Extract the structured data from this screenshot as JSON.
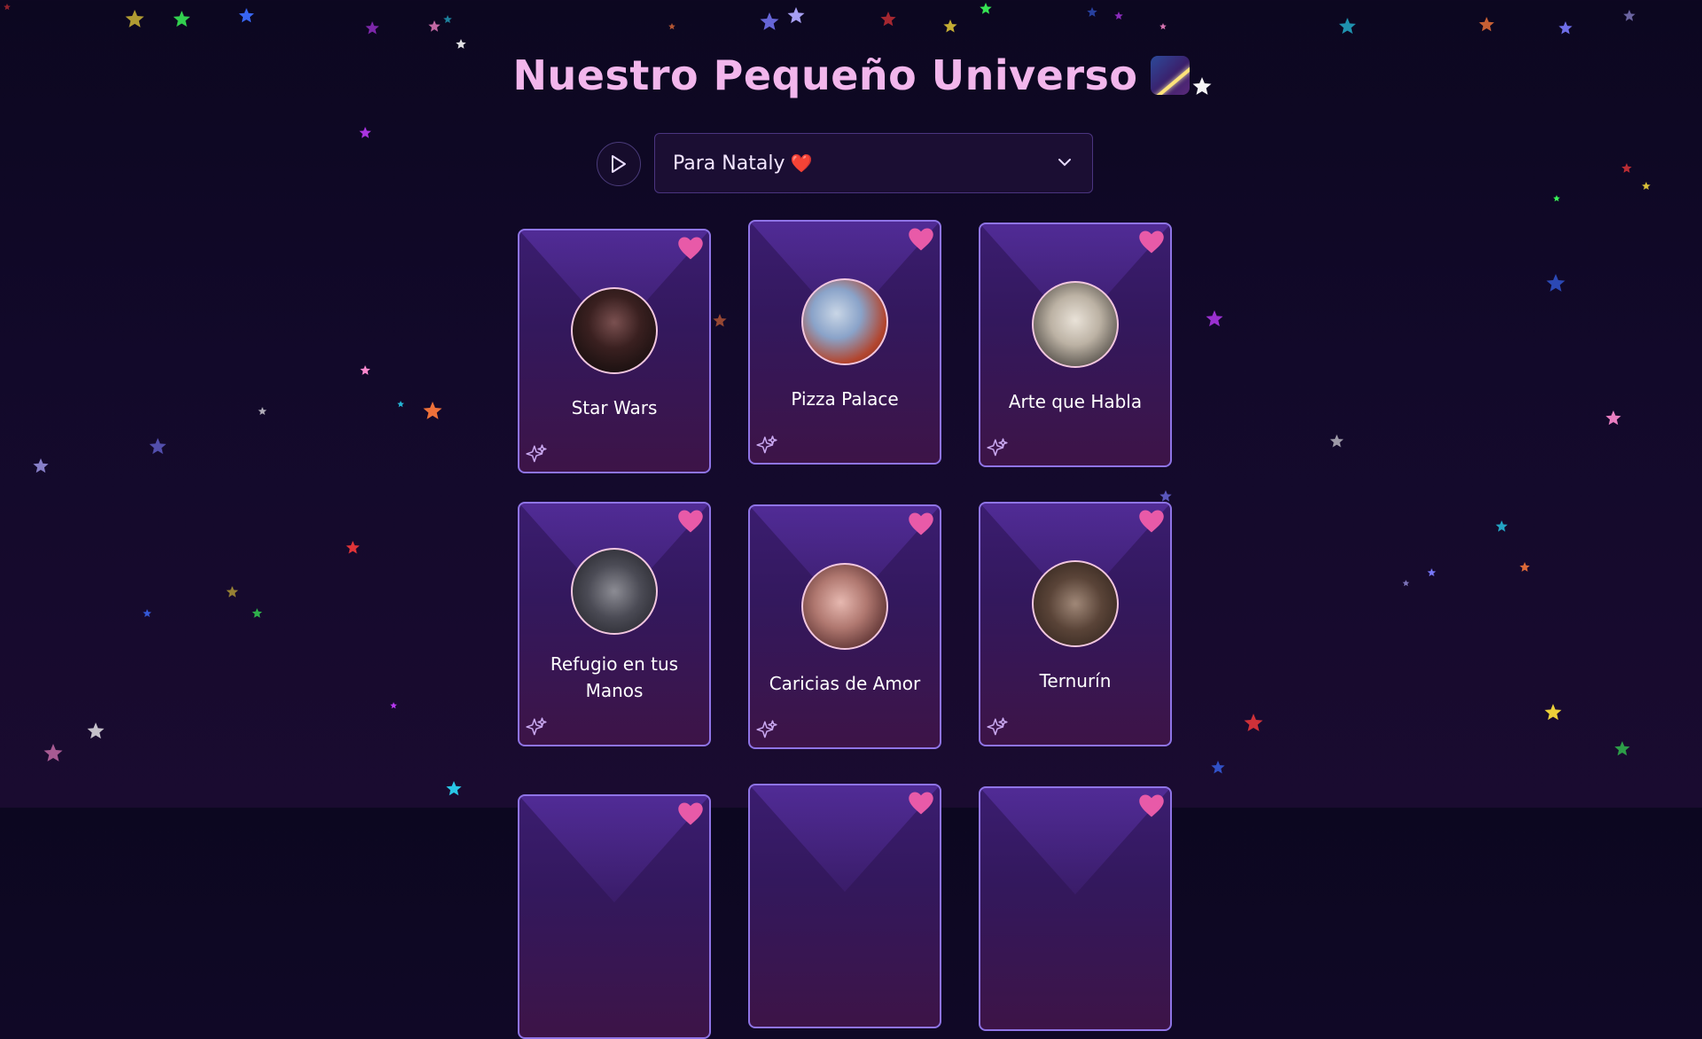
{
  "header": {
    "title": "Nuestro Pequeño Universo"
  },
  "player": {
    "play_icon": "play-icon",
    "selected_song": "Para Nataly",
    "selected_song_emoji": "❤️"
  },
  "cards": [
    {
      "title": "Star Wars",
      "icon": "heart-icon"
    },
    {
      "title": "Pizza Palace",
      "icon": "heart-icon"
    },
    {
      "title": "Arte que Habla",
      "icon": "heart-icon"
    },
    {
      "title": "Refugio en tus Manos",
      "icon": "heart-icon"
    },
    {
      "title": "Caricias de Amor",
      "icon": "heart-icon"
    },
    {
      "title": "Ternurín",
      "icon": "heart-icon"
    },
    {
      "title": "",
      "icon": "heart-icon"
    },
    {
      "title": "",
      "icon": "heart-icon"
    },
    {
      "title": "",
      "icon": "heart-icon"
    }
  ],
  "colors": {
    "accent_pink": "#e85aa8",
    "card_border": "#8f74e6",
    "title": "#f2b6ec"
  }
}
